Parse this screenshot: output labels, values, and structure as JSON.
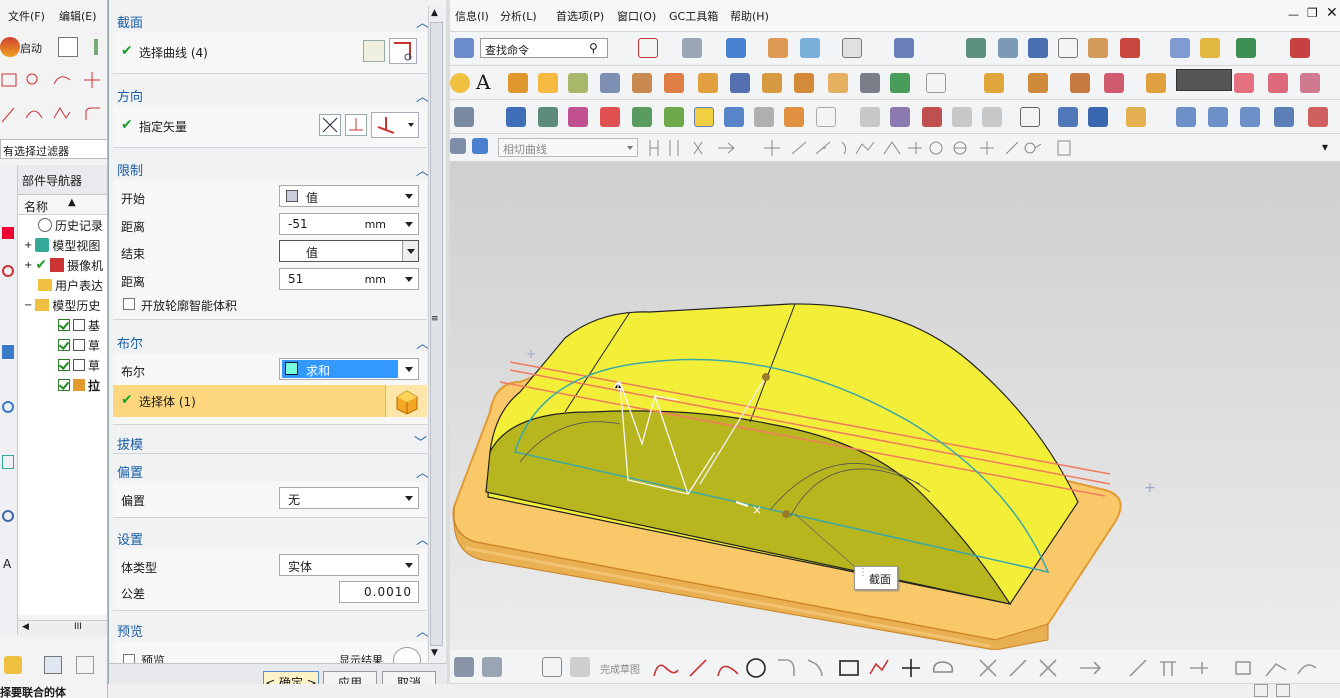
{
  "left_panel": {
    "menu": {
      "file": "文件(F)",
      "edit": "编辑(E)"
    },
    "start_label": "启动",
    "filter_text": "有选择过滤器",
    "navigator_title": "部件导航器",
    "column_name": "名称",
    "tree": [
      "历史记录",
      "模型视图",
      "摄像机",
      "用户表达",
      "模型历史",
      "基",
      "草",
      "草",
      "拉"
    ],
    "status_text": "择要联合的体"
  },
  "dialog": {
    "section": {
      "title": "截面",
      "select_curve": "选择曲线 (4)"
    },
    "direction": {
      "title": "方向",
      "specify_vector": "指定矢量"
    },
    "limits": {
      "title": "限制",
      "start_label": "开始",
      "start_value": "值",
      "distance1_label": "距离",
      "distance1_value": "-51",
      "distance1_unit": "mm",
      "end_label": "结束",
      "end_value": "值",
      "distance2_label": "距离",
      "distance2_value": "51",
      "distance2_unit": "mm",
      "open_profile_label": "开放轮廓智能体积"
    },
    "boolean": {
      "title": "布尔",
      "boolean_label": "布尔",
      "boolean_value": "求和",
      "select_body": "选择体 (1)"
    },
    "draft": {
      "title": "拔模"
    },
    "offset": {
      "title": "偏置",
      "offset_label": "偏置",
      "offset_value": "无"
    },
    "settings": {
      "title": "设置",
      "body_type_label": "体类型",
      "body_type_value": "实体",
      "tolerance_label": "公差",
      "tolerance_value": "0.0010"
    },
    "preview": {
      "title": "预览",
      "preview_label": "预览",
      "show_result": "显示结果"
    },
    "buttons": {
      "ok": "< 确定 >",
      "apply": "应用",
      "cancel": "取消"
    }
  },
  "main": {
    "menu": [
      "信息(I)",
      "分析(L)",
      "首选项(P)",
      "窗口(O)",
      "GC工具箱",
      "帮助(H)"
    ],
    "search_placeholder": "查找命令",
    "curve_filter": "相切曲线",
    "finish_sketch": "完成草图",
    "tooltip": "截面",
    "colors": {
      "accent": "#1b5fa6",
      "body_yellow": "#f2ef3a",
      "plate_orange": "#f7c564",
      "viewport": "#d9d9d9"
    }
  }
}
